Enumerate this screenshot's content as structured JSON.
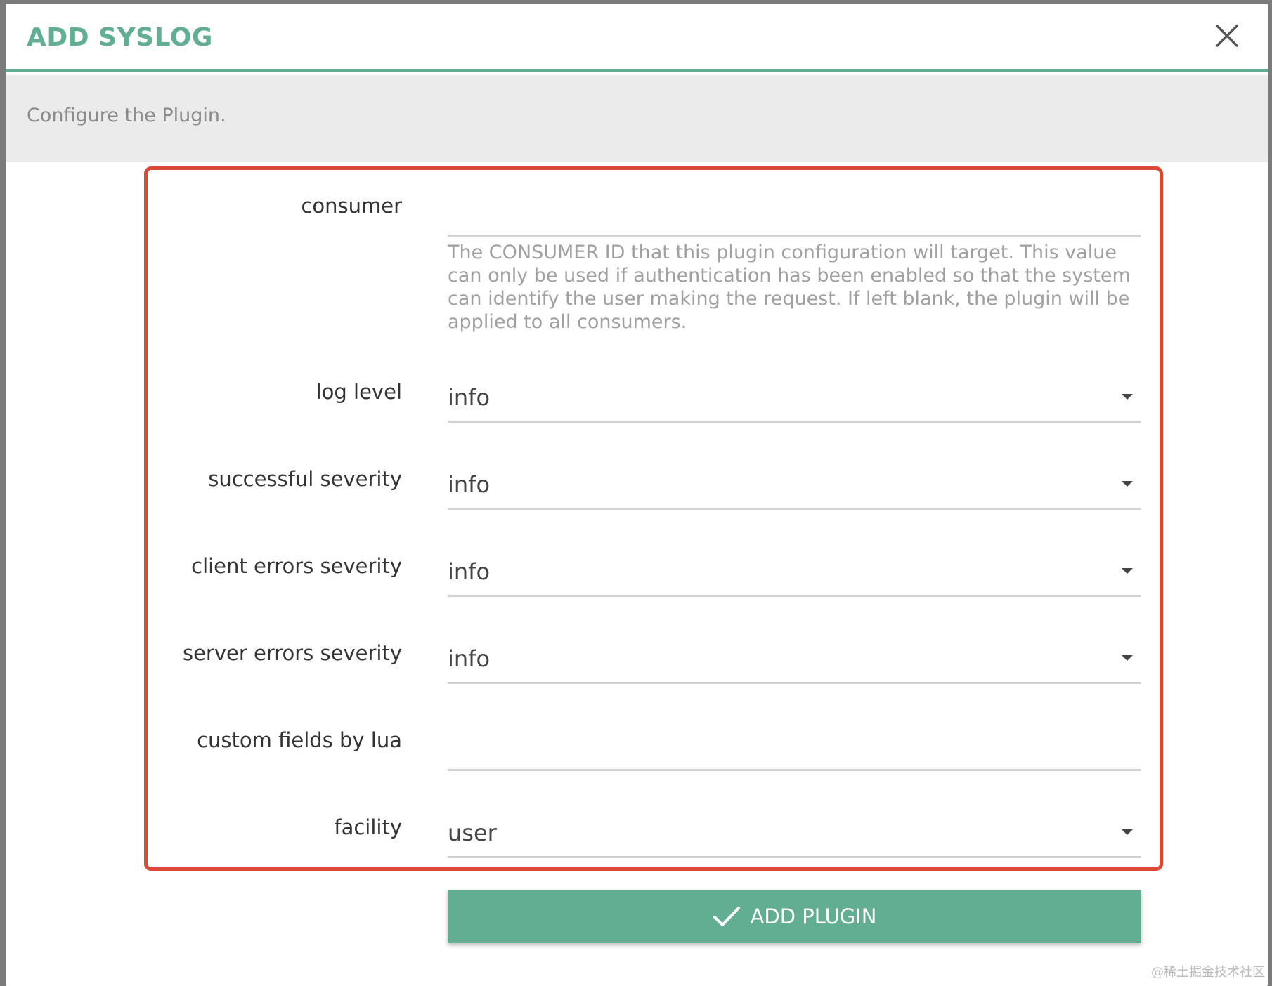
{
  "modal": {
    "title": "ADD SYSLOG",
    "subtitle": "Configure the Plugin."
  },
  "form": {
    "consumer": {
      "label": "consumer",
      "value": "",
      "help": "The CONSUMER ID that this plugin configuration will target. This value can only be used if authentication has been enabled so that the system can identify the user making the request. If left blank, the plugin will be applied to all consumers."
    },
    "log_level": {
      "label": "log level",
      "value": "info"
    },
    "successful_severity": {
      "label": "successful severity",
      "value": "info"
    },
    "client_errors_severity": {
      "label": "client errors severity",
      "value": "info"
    },
    "server_errors_severity": {
      "label": "server errors severity",
      "value": "info"
    },
    "custom_fields_by_lua": {
      "label": "custom fields by lua",
      "value": ""
    },
    "facility": {
      "label": "facility",
      "value": "user"
    }
  },
  "actions": {
    "add_plugin_label": "ADD PLUGIN"
  },
  "icons": {
    "close": "close-icon",
    "check": "check-icon",
    "dropdown": "chevron-down-icon"
  },
  "watermark": "@稀土掘金技术社区",
  "colors": {
    "accent": "#62ae93",
    "highlight_border": "#d94a36",
    "subheader_bg": "#ebebeb"
  }
}
